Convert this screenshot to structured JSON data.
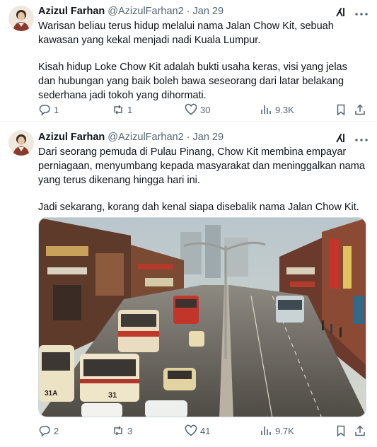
{
  "tweets": [
    {
      "author_name": "Azizul Farhan",
      "handle": "@AzizulFarhan2",
      "separator": "·",
      "date": "Jan 29",
      "paragraphs": [
        "Warisan beliau terus hidup melalui nama Jalan Chow Kit, sebuah kawasan yang kekal menjadi nadi Kuala Lumpur.",
        "Kisah hidup Loke Chow Kit adalah bukti usaha keras, visi yang jelas dan hubungan yang baik boleh bawa seseorang dari latar belakang sederhana jadi tokoh yang dihormati."
      ],
      "stats": {
        "replies": "1",
        "reposts": "1",
        "likes": "30",
        "views": "9.3K"
      }
    },
    {
      "author_name": "Azizul Farhan",
      "handle": "@AzizulFarhan2",
      "separator": "·",
      "date": "Jan 29",
      "paragraphs": [
        "Dari seorang pemuda di Pulau Pinang, Chow Kit membina empayar perniagaan, menyumbang kepada masyarakat dan meninggalkan nama yang terus dikenang hingga hari ini.",
        "Jadi sekarang, korang dah kenal siapa disebalik nama Jalan Chow Kit."
      ],
      "photo_signs": {
        "bus_left": "31A",
        "bus_center": "31"
      },
      "stats": {
        "replies": "2",
        "reposts": "3",
        "likes": "41",
        "views": "9.7K"
      }
    }
  ],
  "icons": {
    "reply": "reply-icon",
    "repost": "repost-icon",
    "like": "heart-icon",
    "views": "views-icon",
    "bookmark": "bookmark-icon",
    "share": "share-icon",
    "grok": "grok-icon",
    "more": "more-icon"
  },
  "colors": {
    "text": "#0f1419",
    "secondary": "#536471",
    "divider": "#eff3f4",
    "thread_line": "#cfd9de"
  }
}
